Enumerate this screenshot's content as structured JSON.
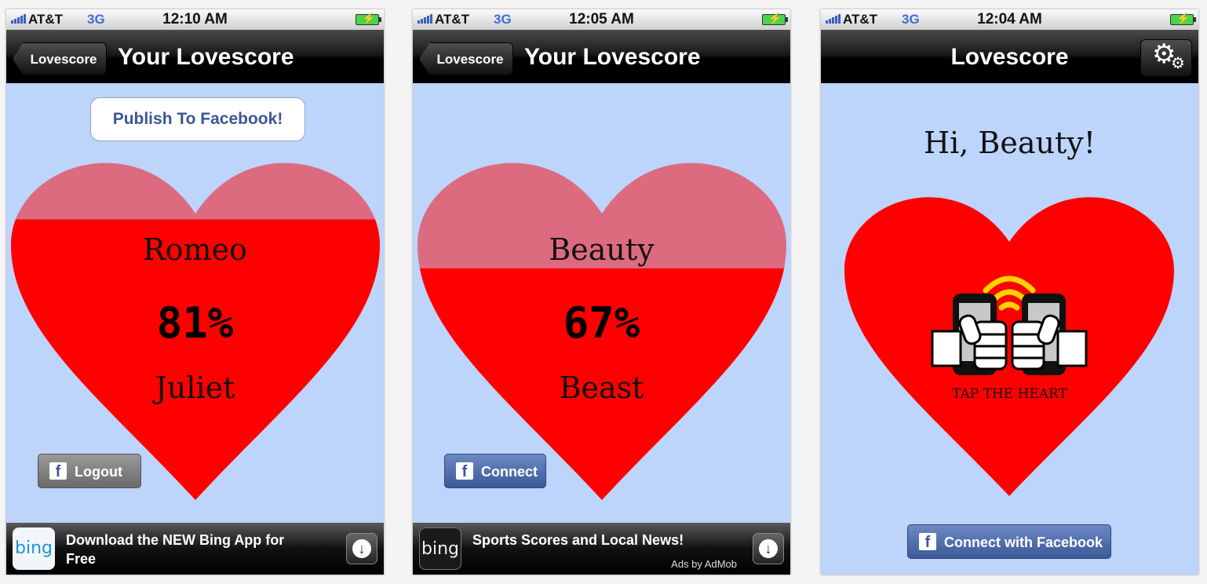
{
  "colors": {
    "screen_bg": "#bdd4fb",
    "heart_fill": "#ff0000",
    "heart_empty": "#dc6b80",
    "facebook_blue": "#3b5998",
    "wifi_yellow": "#ffd200"
  },
  "status_bar": {
    "carrier": "AT&T",
    "network": "3G"
  },
  "screens": [
    {
      "time": "12:10 AM",
      "back_label": "Lovescore",
      "title": "Your Lovescore",
      "publish_label": "Publish To Facebook!",
      "name_top": "Romeo",
      "score": "81%",
      "score_value": 0.81,
      "name_bottom": "Juliet",
      "fb_label": "Logout",
      "ad": {
        "logo": "bing",
        "text": "Download the NEW Bing App for Free",
        "by": ""
      }
    },
    {
      "time": "12:05 AM",
      "back_label": "Lovescore",
      "title": "Your Lovescore",
      "name_top": "Beauty",
      "score": "67%",
      "score_value": 0.67,
      "name_bottom": "Beast",
      "fb_label": "Connect",
      "ad": {
        "logo": "bing",
        "text": "Sports Scores and Local News!",
        "by": "Ads by AdMob"
      }
    },
    {
      "time": "12:04 AM",
      "title": "Lovescore",
      "settings_icon": "gear-icon",
      "greeting": "Hi, Beauty!",
      "tap_label": "TAP THE HEART",
      "fb_label": "Connect with Facebook"
    }
  ]
}
